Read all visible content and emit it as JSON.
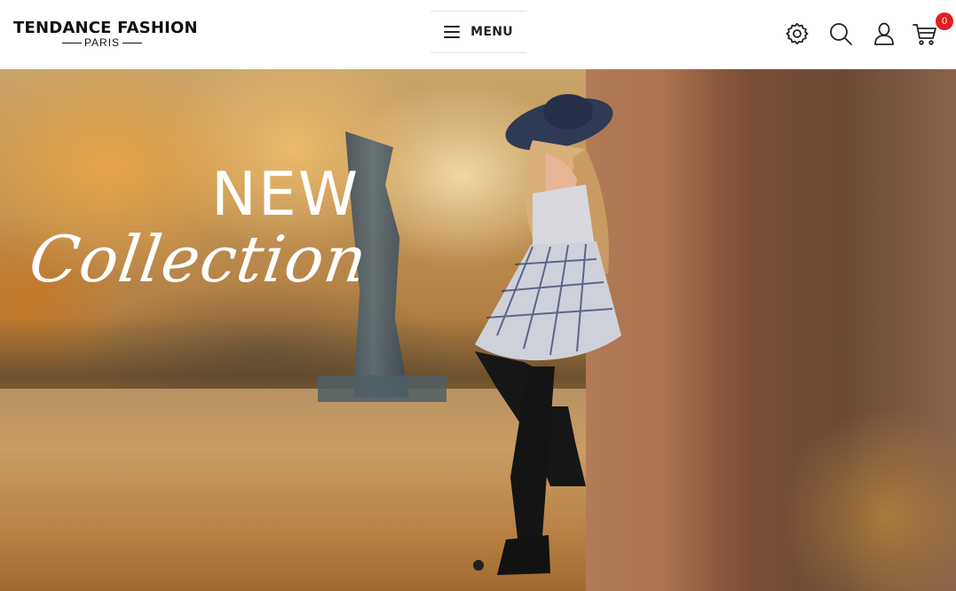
{
  "header": {
    "logo": {
      "main": "TENDANCE FASHION",
      "sub": "PARIS"
    },
    "menu_label": "MENU",
    "icons": {
      "settings": "settings-icon",
      "search": "search-icon",
      "account": "account-icon",
      "cart": "cart-icon"
    },
    "cart_count": "0"
  },
  "hero": {
    "headline": "NEW",
    "script": "Collection",
    "slides": 1,
    "active_slide": 1
  },
  "colors": {
    "badge": "#e02020",
    "text_dark": "#111111",
    "headline": "#ffffff"
  }
}
